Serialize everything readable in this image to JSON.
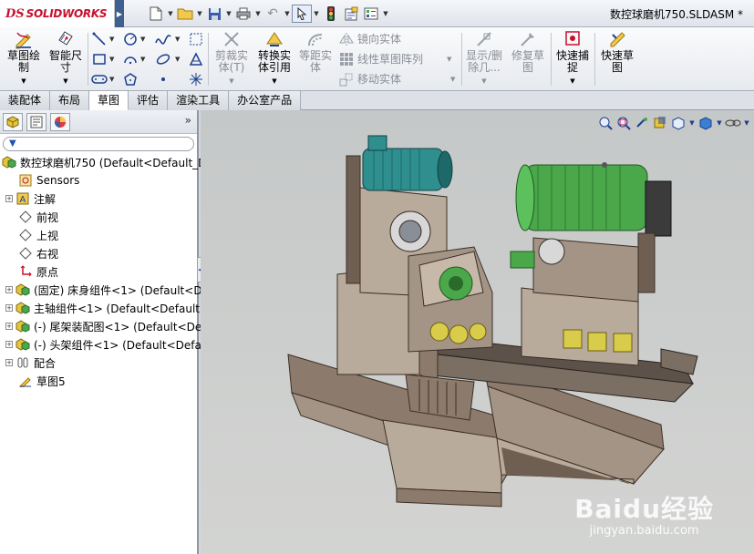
{
  "app": {
    "logo_ds": "DS",
    "logo_text": "SOLIDWORKS",
    "document_title": "数控球磨机750.SLDASM *"
  },
  "ribbon": {
    "sketch_label_1": "草图绘",
    "sketch_label_2": "制",
    "dimension_label_1": "智能尺",
    "dimension_label_2": "寸",
    "trim_label_1": "剪裁实",
    "trim_label_2": "体(T)",
    "convert_label_1": "转换实",
    "convert_label_2": "体引用",
    "offset_label_1": "等距实",
    "offset_label_2": "体",
    "mirror_label": "镜向实体",
    "pattern_label": "线性草图阵列",
    "move_label": "移动实体",
    "show_delete_1": "显示/删",
    "show_delete_2": "除几...",
    "repair_1": "修复草",
    "repair_2": "图",
    "snap_1": "快速捕",
    "snap_2": "捉",
    "rapid_1": "快速草",
    "rapid_2": "图"
  },
  "tabs": [
    {
      "label": "装配体"
    },
    {
      "label": "布局"
    },
    {
      "label": "草图"
    },
    {
      "label": "评估"
    },
    {
      "label": "渲染工具"
    },
    {
      "label": "办公室产品"
    }
  ],
  "tree": {
    "root": "数控球磨机750  (Default<Default_D",
    "sensors": "Sensors",
    "annotations": "注解",
    "front": "前视",
    "top": "上视",
    "right": "右视",
    "origin": "原点",
    "part1": "(固定) 床身组件<1> (Default<D",
    "part2": "主轴组件<1> (Default<Default",
    "part3": "(-) 尾架装配图<1> (Default<De",
    "part4": "(-) 头架组件<1> (Default<Defa",
    "mates": "配合",
    "sketch": "草图5"
  },
  "watermark": {
    "logo": "Baidu经验",
    "url": "jingyan.baidu.com"
  },
  "colors": {
    "brand": "#c8102e",
    "machine_body": "#a39485",
    "motor_teal": "#2f8f8f",
    "motor_green": "#4aa84a",
    "yellow_block": "#d8cc4a"
  }
}
